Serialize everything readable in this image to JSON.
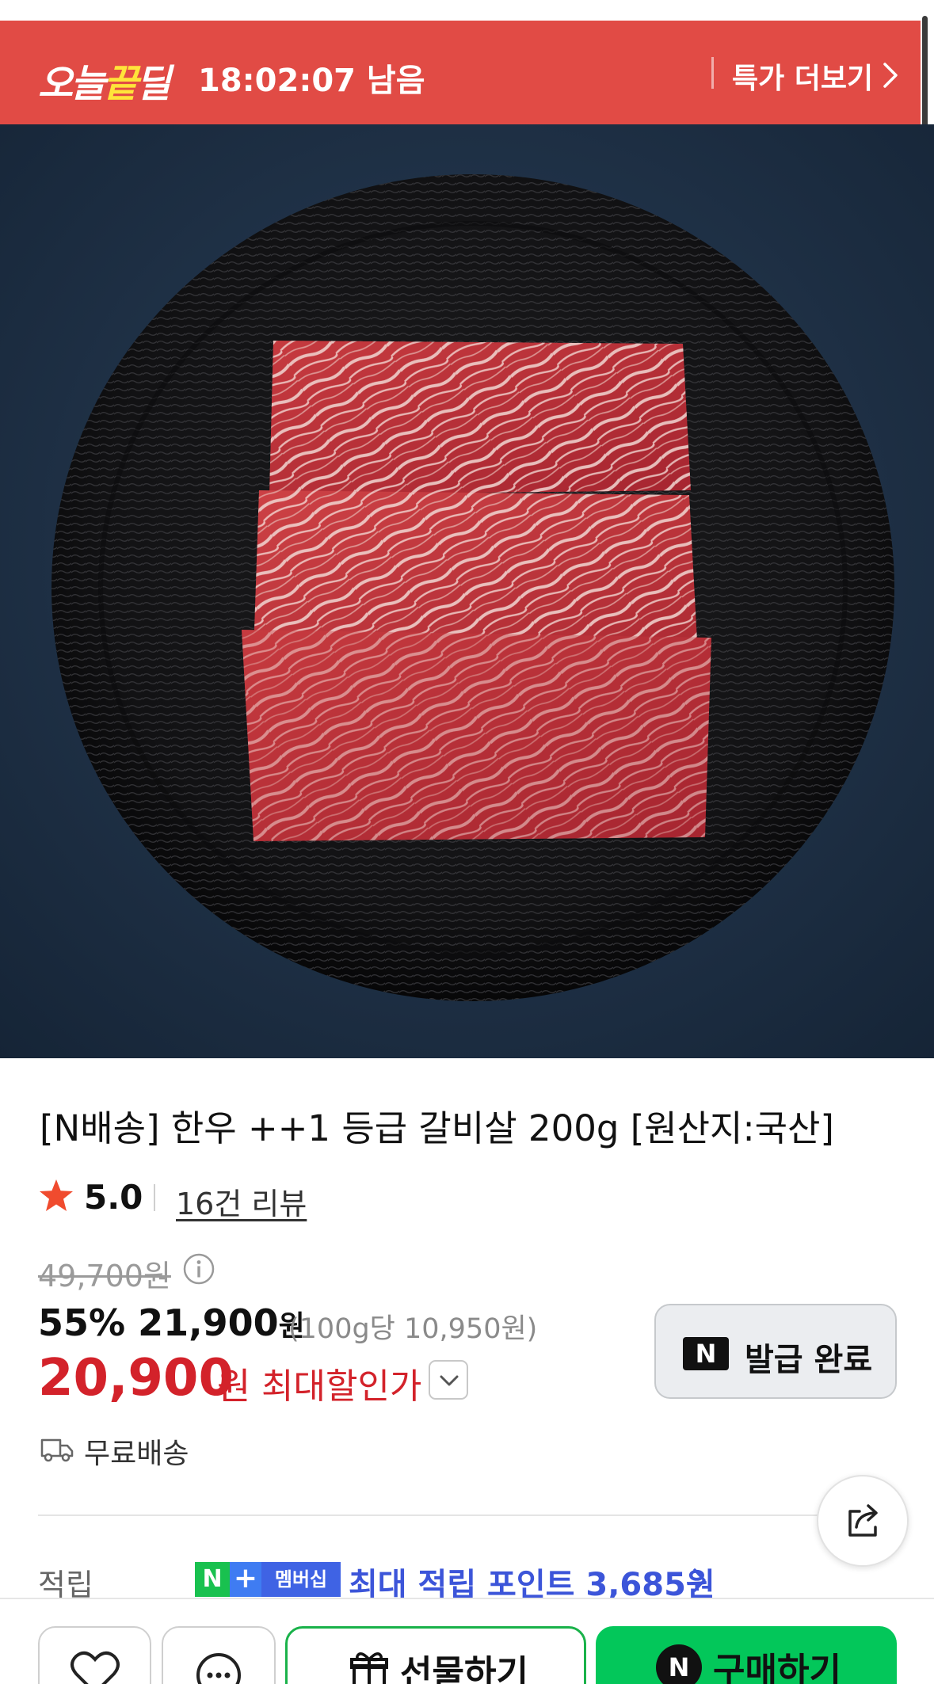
{
  "deal_banner": {
    "logo_part1": "오늘",
    "logo_highlight": "끝",
    "logo_part2": "딜",
    "timer": "18:02:07 남음",
    "more_label": "특가 더보기",
    "background_color": "#e14b45",
    "highlight_color": "#ffe43a"
  },
  "product": {
    "title": "[N배송] 한우 ++1 등급 갈비살 200g [원산지:국산]",
    "image_alt": "product-photo-beef-rib-on-black-plate"
  },
  "rating": {
    "score": "5.0",
    "review_link": "16건 리뷰",
    "star_icon": "star-icon",
    "star_color": "#f04b2e"
  },
  "price": {
    "original": "49,700원",
    "discount_percent": "55%",
    "sale_price": "21,900",
    "sale_currency": "원",
    "unit_price": "(100g당 10,950원)",
    "max_discount_price": "20,900",
    "max_discount_currency": "원",
    "max_discount_label": "최대할인가",
    "accent_color": "#d3222a"
  },
  "coupon": {
    "badge": "N",
    "label": "발급 완료"
  },
  "shipping": {
    "label": "무료배송",
    "icon": "truck-icon"
  },
  "points": {
    "label": "적립",
    "badge_n": "N",
    "badge_plus": "+",
    "badge_text": "멤버십",
    "text": "최대 적립 포인트 3,685원",
    "color": "#3c55d9"
  },
  "bottom_bar": {
    "gift_label": "선물하기",
    "buy_badge": "N",
    "buy_label": "구매하기",
    "buy_color": "#03c75a"
  }
}
